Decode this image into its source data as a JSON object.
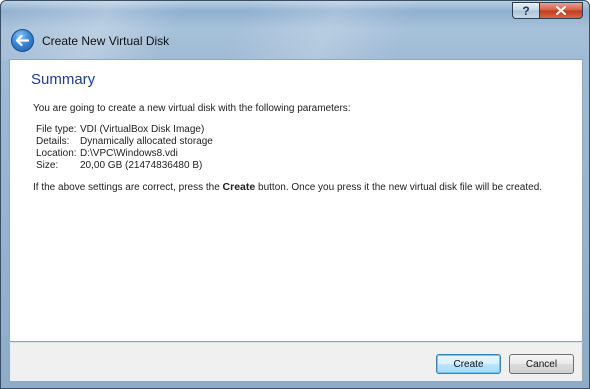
{
  "window": {
    "title": "Create New Virtual Disk",
    "help_label": "?",
    "close_label": "x"
  },
  "page": {
    "heading": "Summary",
    "intro": "You are going to create a new virtual disk with the following parameters:",
    "params": [
      {
        "label": "File type:",
        "value": "VDI (VirtualBox Disk Image)"
      },
      {
        "label": "Details:",
        "value": "Dynamically allocated storage"
      },
      {
        "label": "Location:",
        "value": "D:\\VPC\\Windows8.vdi"
      },
      {
        "label": "Size:",
        "value": "20,00 GB (21474836480 B)"
      }
    ],
    "confirm_before": "If the above settings are correct, press the ",
    "confirm_bold": "Create",
    "confirm_after": " button. Once you press it the new virtual disk file will be created."
  },
  "buttons": {
    "create": "Create",
    "cancel": "Cancel"
  }
}
